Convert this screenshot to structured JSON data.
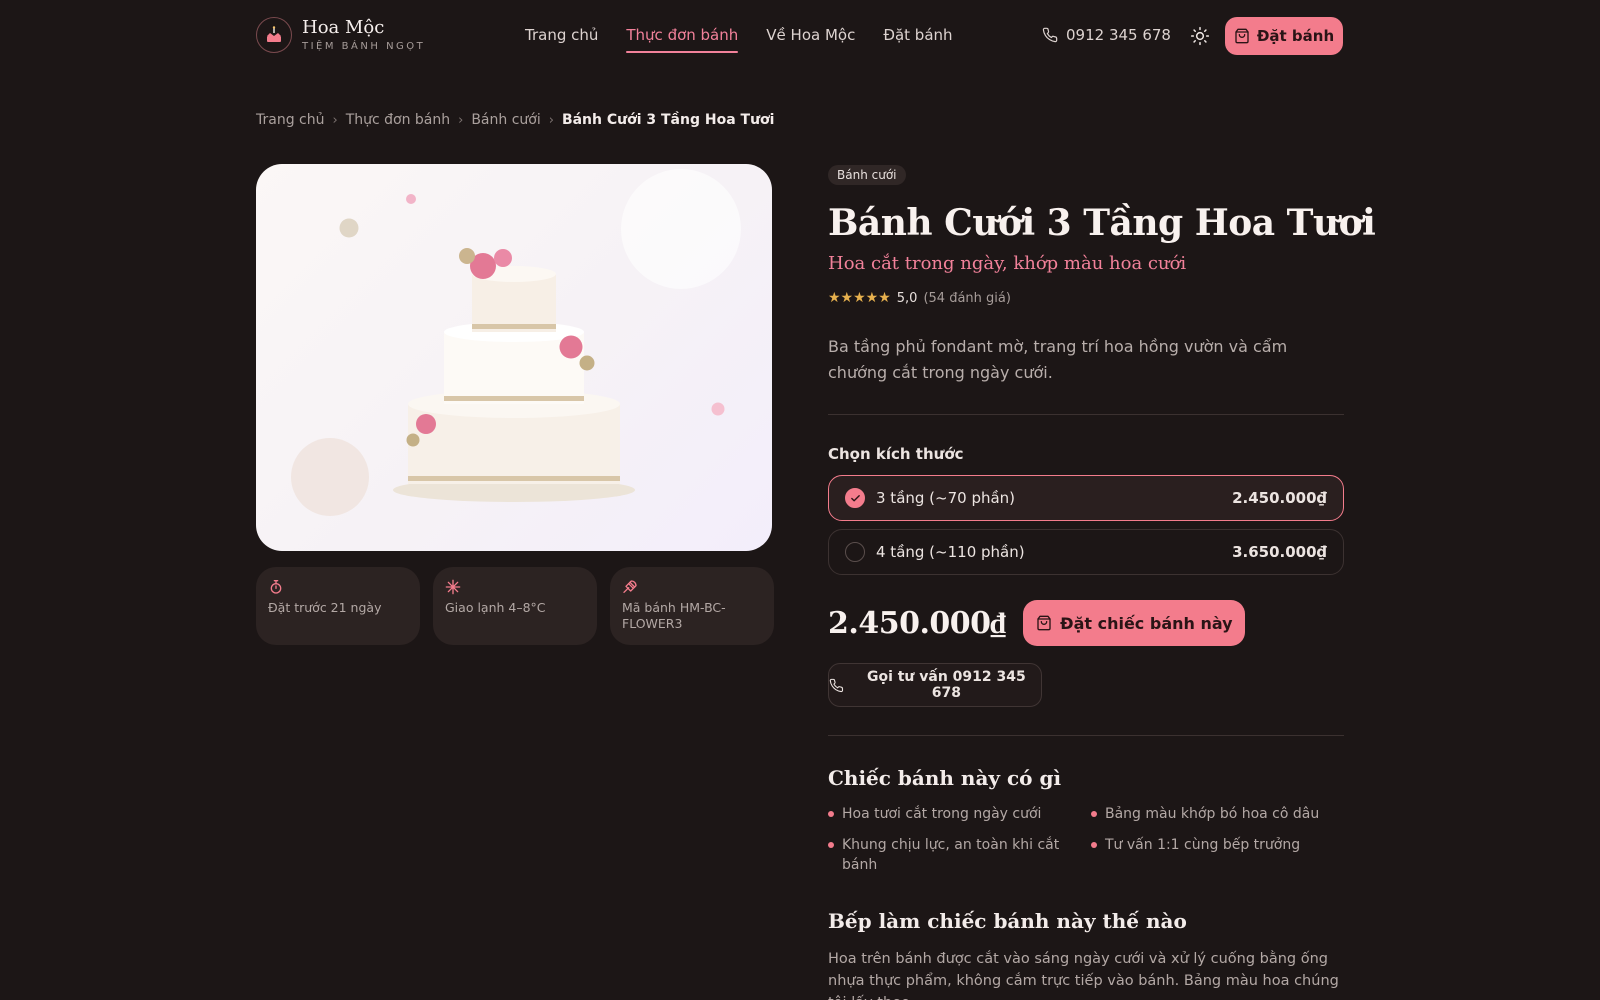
{
  "brand": {
    "name": "Hoa Mộc",
    "tagline": "TIỆM BÁNH NGỌT",
    "accent_color": "#f37c8c"
  },
  "nav": {
    "items": [
      {
        "label": "Trang chủ",
        "active": false
      },
      {
        "label": "Thực đơn bánh",
        "active": true
      },
      {
        "label": "Về Hoa Mộc",
        "active": false
      },
      {
        "label": "Đặt bánh",
        "active": false
      }
    ]
  },
  "header": {
    "phone": "0912 345 678",
    "theme_icon": "sun-icon",
    "order_label": "Đặt bánh"
  },
  "breadcrumb": [
    "Trang chủ",
    "Thực đơn bánh",
    "Bánh cưới",
    "Bánh Cưới 3 Tầng Hoa Tươi"
  ],
  "info_cards": [
    {
      "icon": "timer-icon",
      "text": "Đặt trước 21 ngày"
    },
    {
      "icon": "snowflake-icon",
      "text": "Giao lạnh 4–8°C"
    },
    {
      "icon": "tag-icon",
      "text": "Mã bánh HM-BC-FLOWER3"
    }
  ],
  "product": {
    "category": "Bánh cưới",
    "title": "Bánh Cưới 3 Tầng Hoa Tươi",
    "subtitle": "Hoa cắt trong ngày, khớp màu hoa cưới",
    "rating_stars": 5,
    "rating_value": "5,0",
    "rating_count": "(54 đánh giá)",
    "description": "Ba tầng phủ fondant mờ, trang trí hoa hồng vườn và cẩm chướng cắt trong ngày cưới."
  },
  "sizes": {
    "label": "Chọn kích thước",
    "options": [
      {
        "label": "3 tầng (~70 phần)",
        "price": "2.450.000₫",
        "selected": true
      },
      {
        "label": "4 tầng (~110 phần)",
        "price": "3.650.000₫",
        "selected": false
      }
    ]
  },
  "purchase": {
    "price": "2.450.000₫",
    "buy_label": "Đặt chiếc bánh này",
    "call_label": "Gọi tư vấn 0912 345 678"
  },
  "features": {
    "title": "Chiếc bánh này có gì",
    "items": [
      "Hoa tươi cắt trong ngày cưới",
      "Bảng màu khớp bó hoa cô dâu",
      "Khung chịu lực, an toàn khi cắt bánh",
      "Tư vấn 1:1 cùng bếp trưởng"
    ]
  },
  "how": {
    "title": "Bếp làm chiếc bánh này thế nào",
    "text": "Hoa trên bánh được cắt vào sáng ngày cưới và xử lý cuống bằng ống nhựa thực phẩm, không cắm trực tiếp vào bánh. Bảng màu hoa chúng tôi lấy theo"
  }
}
